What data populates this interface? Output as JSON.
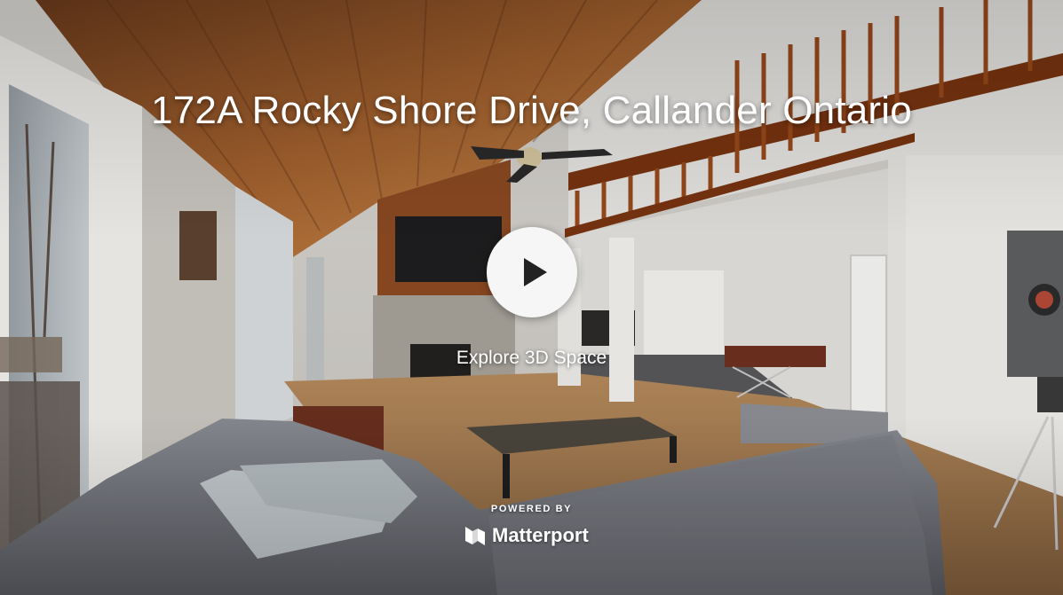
{
  "listing": {
    "title": "172A Rocky Shore Drive, Callander Ontario"
  },
  "player": {
    "play_icon": "play-icon",
    "explore_label": "Explore 3D Space"
  },
  "branding": {
    "powered_by": "POWERED BY",
    "brand_icon": "matterport-logo-icon",
    "brand_name": "Matterport"
  },
  "colors": {
    "title_text": "#ffffff",
    "play_button_bg": "#f6f6f6",
    "play_icon": "#222222"
  }
}
